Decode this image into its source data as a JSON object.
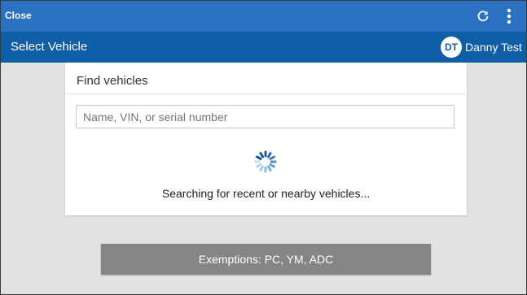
{
  "topbar": {
    "close_label": "Close",
    "refresh_icon": "refresh-icon",
    "menu_icon": "more-vert-icon"
  },
  "header": {
    "title": "Select Vehicle",
    "user_initials": "DT",
    "user_name": "Danny Test"
  },
  "card": {
    "title": "Find vehicles",
    "search_placeholder": "Name, VIN, or serial number",
    "search_value": "",
    "status_text": "Searching for recent or nearby vehicles..."
  },
  "exemptions": {
    "label": "Exemptions: PC, YM, ADC"
  },
  "colors": {
    "topbar": "#2a71c2",
    "titlebar": "#105ea5",
    "background": "#e2e2e2",
    "button": "#858585"
  }
}
